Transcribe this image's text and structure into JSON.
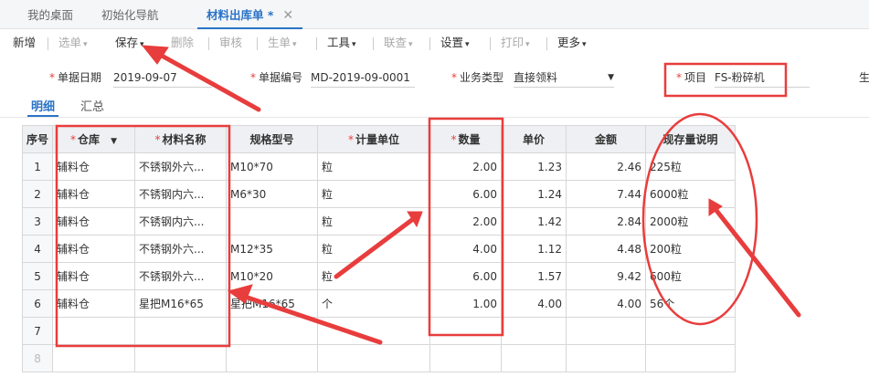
{
  "tabs": [
    {
      "label": "我的桌面"
    },
    {
      "label": "初始化导航"
    },
    {
      "label": "材料出库单 *"
    }
  ],
  "toolbar": {
    "new": "新增",
    "select_order": "选单",
    "save": "保存",
    "delete": "删除",
    "audit": "审核",
    "generate": "生单",
    "tools": "工具",
    "query": "联查",
    "settings": "设置",
    "print": "打印",
    "more": "更多"
  },
  "form": {
    "date_label": "单据日期",
    "date_value": "2019-09-07",
    "number_label": "单据编号",
    "number_value": "MD-2019-09-0001",
    "biz_type_label": "业务类型",
    "biz_type_value": "直接领料",
    "project_label": "项目",
    "project_value": "FS-粉碎机",
    "cut_label": "生"
  },
  "subtabs": [
    {
      "label": "明细"
    },
    {
      "label": "汇总"
    }
  ],
  "grid": {
    "headers": {
      "seq": "序号",
      "warehouse": "仓库",
      "material": "材料名称",
      "spec": "规格型号",
      "unit": "计量单位",
      "qty": "数量",
      "price": "单价",
      "amount": "金额",
      "stock": "现存量说明"
    },
    "rows": [
      {
        "seq": "1",
        "warehouse": "辅料仓",
        "material": "不锈钢外六...",
        "spec": "M10*70",
        "unit": "粒",
        "qty": "2.00",
        "price": "1.23",
        "amount": "2.46",
        "stock": "225粒"
      },
      {
        "seq": "2",
        "warehouse": "辅料仓",
        "material": "不锈钢内六...",
        "spec": "M6*30",
        "unit": "粒",
        "qty": "6.00",
        "price": "1.24",
        "amount": "7.44",
        "stock": "6000粒"
      },
      {
        "seq": "3",
        "warehouse": "辅料仓",
        "material": "不锈钢内六...",
        "spec": "",
        "unit": "粒",
        "qty": "2.00",
        "price": "1.42",
        "amount": "2.84",
        "stock": "2000粒"
      },
      {
        "seq": "4",
        "warehouse": "辅料仓",
        "material": "不锈钢外六...",
        "spec": "M12*35",
        "unit": "粒",
        "qty": "4.00",
        "price": "1.12",
        "amount": "4.48",
        "stock": "200粒"
      },
      {
        "seq": "5",
        "warehouse": "辅料仓",
        "material": "不锈钢外六...",
        "spec": "M10*20",
        "unit": "粒",
        "qty": "6.00",
        "price": "1.57",
        "amount": "9.42",
        "stock": "600粒"
      },
      {
        "seq": "6",
        "warehouse": "辅料仓",
        "material": "星把M16*65",
        "spec": "星把M16*65",
        "unit": "个",
        "qty": "1.00",
        "price": "4.00",
        "amount": "4.00",
        "stock": "56个"
      },
      {
        "seq": "7",
        "warehouse": "",
        "material": "",
        "spec": "",
        "unit": "",
        "qty": "",
        "price": "",
        "amount": "",
        "stock": ""
      },
      {
        "seq": "8",
        "warehouse": "",
        "material": "",
        "spec": "",
        "unit": "",
        "qty": "",
        "price": "",
        "amount": "",
        "stock": ""
      }
    ]
  },
  "icons": {
    "caret": "chevron-down-icon",
    "close": "close-icon",
    "filter": "dropdown-arrow-icon"
  },
  "colors": {
    "accent": "#2a73c6",
    "required": "#e64040",
    "annotation": "#e83d3d"
  }
}
